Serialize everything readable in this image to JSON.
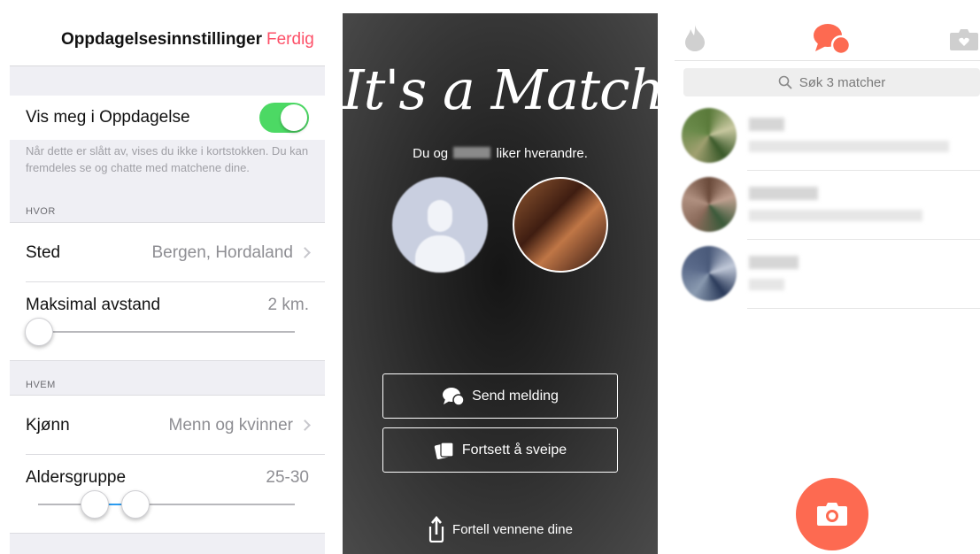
{
  "settings": {
    "title": "Oppdagelsesinnstillinger",
    "done_label": "Ferdig",
    "show_me_label": "Vis meg i Oppdagelse",
    "show_me_on": true,
    "show_me_footnote": "Når dette er slått av, vises du ikke i kortstokken. Du kan fremdeles se og chatte med matchene dine.",
    "where_header": "HVOR",
    "location_label": "Sted",
    "location_value": "Bergen, Hordaland",
    "max_distance_label": "Maksimal avstand",
    "max_distance_value": "2 km.",
    "max_distance_fraction": 0,
    "who_header": "HVEM",
    "gender_label": "Kjønn",
    "gender_value": "Menn og kvinner",
    "age_label": "Aldersgruppe",
    "age_value": "25-30",
    "toggle_color": "#4cd964",
    "accent_color": "#fd5068"
  },
  "match": {
    "headline": "It's a Match!",
    "sub_prefix": "Du og",
    "sub_suffix": "liker hverandre.",
    "send_message_label": "Send melding",
    "send_message_icon": "chat-bubble-icon",
    "keep_swiping_label": "Fortsett å sveipe",
    "keep_swiping_icon": "cards-icon",
    "tell_friends_label": "Fortell vennene dine",
    "tell_friends_icon": "share-icon"
  },
  "messages": {
    "tabs": [
      {
        "icon": "flame-icon",
        "active": false
      },
      {
        "icon": "chat-bubbles-icon",
        "active": true
      },
      {
        "icon": "camera-icon",
        "active": false
      }
    ],
    "search_placeholder": "Søk 3 matcher",
    "conversation_count": 3,
    "fab_icon": "camera-icon",
    "brand_color": "#fd6a51"
  }
}
